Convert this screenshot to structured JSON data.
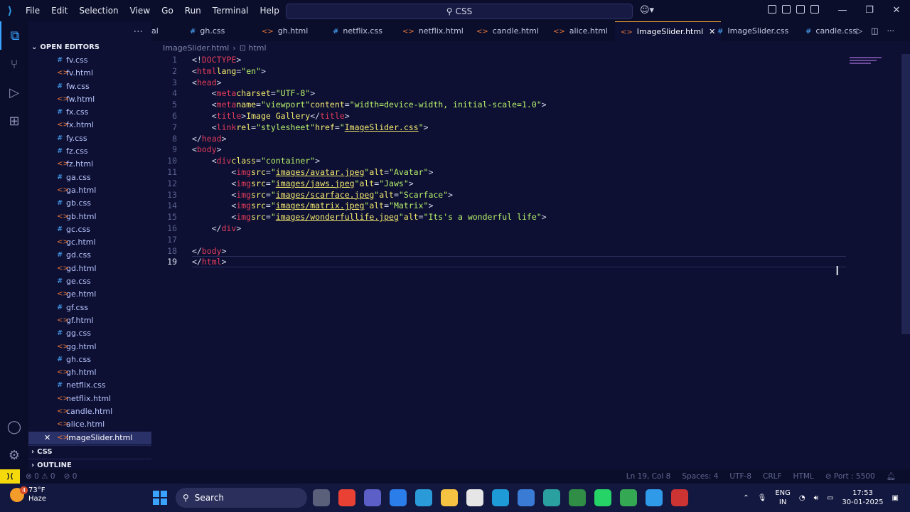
{
  "titlebar": {
    "menu": [
      "File",
      "Edit",
      "Selection",
      "View",
      "Go",
      "Run",
      "Terminal",
      "Help"
    ],
    "search_text": "CSS"
  },
  "sidebar": {
    "section_open_editors": "OPEN EDITORS",
    "files": [
      {
        "name": "fv.css",
        "type": "css"
      },
      {
        "name": "fv.html",
        "type": "html"
      },
      {
        "name": "fw.css",
        "type": "css"
      },
      {
        "name": "fw.html",
        "type": "html"
      },
      {
        "name": "fx.css",
        "type": "css"
      },
      {
        "name": "fx.html",
        "type": "html"
      },
      {
        "name": "fy.css",
        "type": "css"
      },
      {
        "name": "fz.css",
        "type": "css"
      },
      {
        "name": "fz.html",
        "type": "html"
      },
      {
        "name": "ga.css",
        "type": "css"
      },
      {
        "name": "ga.html",
        "type": "html"
      },
      {
        "name": "gb.css",
        "type": "css"
      },
      {
        "name": "gb.html",
        "type": "html"
      },
      {
        "name": "gc.css",
        "type": "css"
      },
      {
        "name": "gc.html",
        "type": "html"
      },
      {
        "name": "gd.css",
        "type": "css"
      },
      {
        "name": "gd.html",
        "type": "html"
      },
      {
        "name": "ge.css",
        "type": "css"
      },
      {
        "name": "ge.html",
        "type": "html"
      },
      {
        "name": "gf.css",
        "type": "css"
      },
      {
        "name": "gf.html",
        "type": "html"
      },
      {
        "name": "gg.css",
        "type": "css"
      },
      {
        "name": "gg.html",
        "type": "html"
      },
      {
        "name": "gh.css",
        "type": "css"
      },
      {
        "name": "gh.html",
        "type": "html"
      },
      {
        "name": "netflix.css",
        "type": "css"
      },
      {
        "name": "netflix.html",
        "type": "html"
      },
      {
        "name": "candle.html",
        "type": "html"
      },
      {
        "name": "alice.html",
        "type": "html"
      },
      {
        "name": "ImageSlider.html",
        "type": "html",
        "active": true
      }
    ],
    "section_css": "CSS",
    "section_outline": "OUTLINE"
  },
  "tabs": [
    {
      "label": "al",
      "type": "css"
    },
    {
      "label": "gh.css",
      "type": "css"
    },
    {
      "label": "gh.html",
      "type": "html"
    },
    {
      "label": "netflix.css",
      "type": "css"
    },
    {
      "label": "netflix.html",
      "type": "html"
    },
    {
      "label": "candle.html",
      "type": "html"
    },
    {
      "label": "alice.html",
      "type": "html"
    },
    {
      "label": "ImageSlider.html",
      "type": "html",
      "active": true
    },
    {
      "label": "ImageSlider.css",
      "type": "css"
    },
    {
      "label": "candle.css",
      "type": "css"
    }
  ],
  "breadcrumb": {
    "file": "ImageSlider.html",
    "node": "html"
  },
  "editor": {
    "current_line": 19,
    "lines": [
      "<!DOCTYPE html>",
      "<html lang=\"en\">",
      "<head>",
      "    <meta charset=\"UTF-8\">",
      "    <meta name=\"viewport\" content=\"width=device-width, initial-scale=1.0\">",
      "    <title>Image Gallery</title>",
      "    <link rel=\"stylesheet\" href=\"ImageSlider.css\">",
      "</head>",
      "<body>",
      "    <div class=\"container\">",
      "        <img src=\"images/avatar.jpeg\" alt=\"Avatar\">",
      "        <img src=\"images/jaws.jpeg\" alt=\"Jaws\">",
      "        <img src=\"images/scarface.jpeg\" alt=\"Scarface\">",
      "        <img src=\"images/matrix.jpeg\" alt=\"Matrix\">",
      "        <img src=\"images/wonderfullife.jpeg\" alt=\"Its's a wonderful life\">",
      "    </div>",
      "",
      "</body>",
      "</html>"
    ]
  },
  "statusbar": {
    "errors": "0",
    "warnings": "0",
    "ports": "0",
    "position": "Ln 19, Col 8",
    "spaces": "Spaces: 4",
    "encoding": "UTF-8",
    "eol": "CRLF",
    "language": "HTML",
    "port": "Port : 5500"
  },
  "taskbar": {
    "weather_badge": "4",
    "temperature": "73°F",
    "condition": "Haze",
    "search_label": "Search",
    "lang_line1": "ENG",
    "lang_line2": "IN",
    "time": "17:53",
    "date": "30-01-2025"
  },
  "colors": {
    "background": "#0d1033",
    "accent": "#3aa3ff",
    "tag": "#e23b5a",
    "attribute": "#f3e96f",
    "string": "#b6f06a"
  }
}
